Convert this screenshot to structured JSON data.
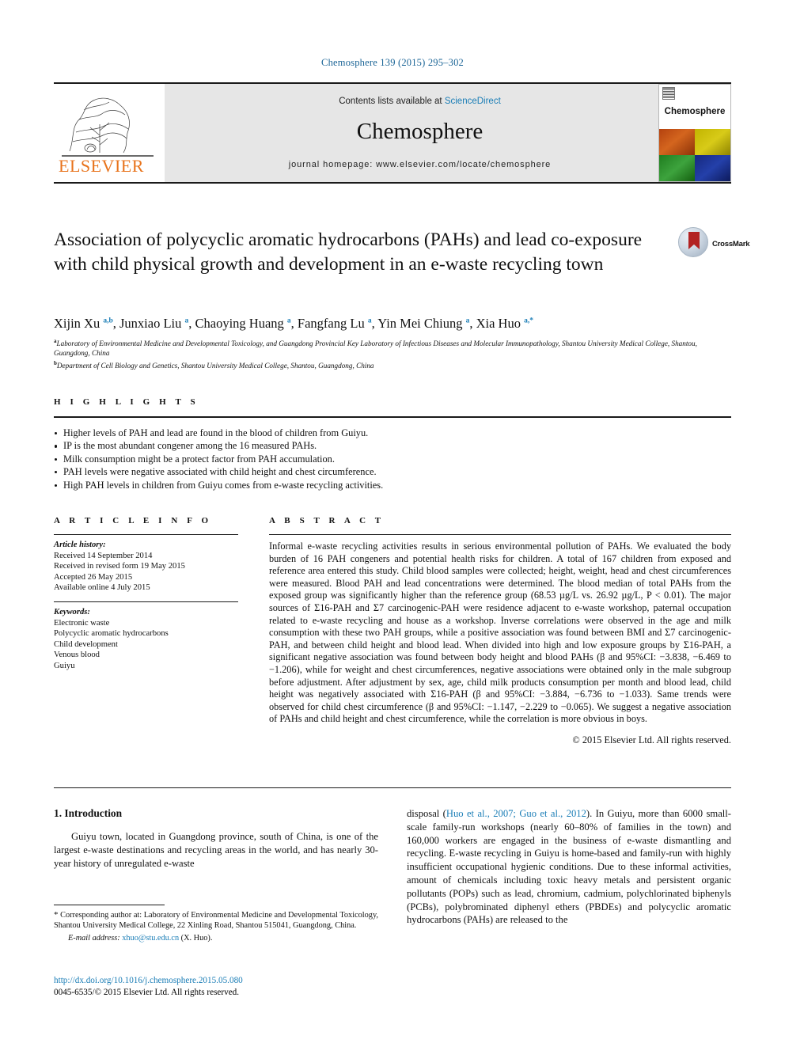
{
  "running_head": "Chemosphere 139 (2015) 295–302",
  "banner": {
    "publisher_logo_text": "ELSEVIER",
    "contents_prefix": "Contents lists available at ",
    "contents_link": "ScienceDirect",
    "journal_name": "Chemosphere",
    "homepage": "journal homepage: www.elsevier.com/locate/chemosphere",
    "cover_title": "Chemosphere"
  },
  "article": {
    "title": "Association of polycyclic aromatic hydrocarbons (PAHs) and lead co-exposure with child physical growth and development in an e-waste recycling town",
    "crossmark_label": "CrossMark",
    "authors_html": "Xijin Xu <sup>a,b</sup>, Junxiao Liu <sup>a</sup>, Chaoying Huang <sup>a</sup>, Fangfang Lu <sup>a</sup>, Yin Mei Chiung <sup>a</sup>, Xia Huo <sup>a,*</sup>",
    "affiliations": [
      "Laboratory of Environmental Medicine and Developmental Toxicology, and Guangdong Provincial Key Laboratory of Infectious Diseases and Molecular Immunopathology, Shantou University Medical College, Shantou, Guangdong, China",
      "Department of Cell Biology and Genetics, Shantou University Medical College, Shantou, Guangdong, China"
    ],
    "affiliation_marks": [
      "a",
      "b"
    ]
  },
  "highlights": {
    "heading": "H I G H L I G H T S",
    "items": [
      "Higher levels of PAH and lead are found in the blood of children from Guiyu.",
      "IP is the most abundant congener among the 16 measured PAHs.",
      "Milk consumption might be a protect factor from PAH accumulation.",
      "PAH levels were negative associated with child height and chest circumference.",
      "High PAH levels in children from Guiyu comes from e-waste recycling activities."
    ]
  },
  "article_info": {
    "heading": "A R T I C L E  I N F O",
    "history_label": "Article history:",
    "history": [
      "Received 14 September 2014",
      "Received in revised form 19 May 2015",
      "Accepted 26 May 2015",
      "Available online 4 July 2015"
    ],
    "keywords_label": "Keywords:",
    "keywords": [
      "Electronic waste",
      "Polycyclic aromatic hydrocarbons",
      "Child development",
      "Venous blood",
      "Guiyu"
    ]
  },
  "abstract": {
    "heading": "A B S T R A C T",
    "text": "Informal e-waste recycling activities results in serious environmental pollution of PAHs. We evaluated the body burden of 16 PAH congeners and potential health risks for children. A total of 167 children from exposed and reference area entered this study. Child blood samples were collected; height, weight, head and chest circumferences were measured. Blood PAH and lead concentrations were determined. The blood median of total PAHs from the exposed group was significantly higher than the reference group (68.53 µg/L vs. 26.92 µg/L, P < 0.01). The major sources of Σ16-PAH and Σ7 carcinogenic-PAH were residence adjacent to e-waste workshop, paternal occupation related to e-waste recycling and house as a workshop. Inverse correlations were observed in the age and milk consumption with these two PAH groups, while a positive association was found between BMI and Σ7 carcinogenic-PAH, and between child height and blood lead. When divided into high and low exposure groups by Σ16-PAH, a significant negative association was found between body height and blood PAHs (β and 95%CI: −3.838, −6.469 to −1.206), while for weight and chest circumferences, negative associations were obtained only in the male subgroup before adjustment. After adjustment by sex, age, child milk products consumption per month and blood lead, child height was negatively associated with Σ16-PAH (β and 95%CI: −3.884, −6.736 to −1.033). Same trends were observed for child chest circumference (β and 95%CI: −1.147, −2.229 to −0.065). We suggest a negative association of PAHs and child height and chest circumference, while the correlation is more obvious in boys.",
    "copyright": "© 2015 Elsevier Ltd. All rights reserved."
  },
  "body": {
    "section_number_title": "1. Introduction",
    "left_paragraph": "Guiyu town, located in Guangdong province, south of China, is one of the largest e-waste destinations and recycling areas in the world, and has nearly 30-year history of unregulated e-waste",
    "right_paragraph_pre": "disposal (",
    "right_paragraph_citation": "Huo et al., 2007; Guo et al., 2012",
    "right_paragraph_post": "). In Guiyu, more than 6000 small-scale family-run workshops (nearly 60–80% of families in the town) and 160,000 workers are engaged in the business of e-waste dismantling and recycling. E-waste recycling in Guiyu is home-based and family-run with highly insufficient occupational hygienic conditions. Due to these informal activities, amount of chemicals including toxic heavy metals and persistent organic pollutants (POPs) such as lead, chromium, cadmium, polychlorinated biphenyls (PCBs), polybrominated diphenyl ethers (PBDEs) and polycyclic aromatic hydrocarbons (PAHs) are released to the"
  },
  "footnote": {
    "star": "*",
    "corresponding_text": "Corresponding author at: Laboratory of Environmental Medicine and Developmental Toxicology, Shantou University Medical College, 22 Xinling Road, Shantou 515041, Guangdong, China.",
    "email_label": "E-mail address:",
    "email": "xhuo@stu.edu.cn",
    "email_owner": "(X. Huo)."
  },
  "footer": {
    "doi": "http://dx.doi.org/10.1016/j.chemosphere.2015.05.080",
    "issn_line": "0045-6535/© 2015 Elsevier Ltd. All rights reserved."
  }
}
